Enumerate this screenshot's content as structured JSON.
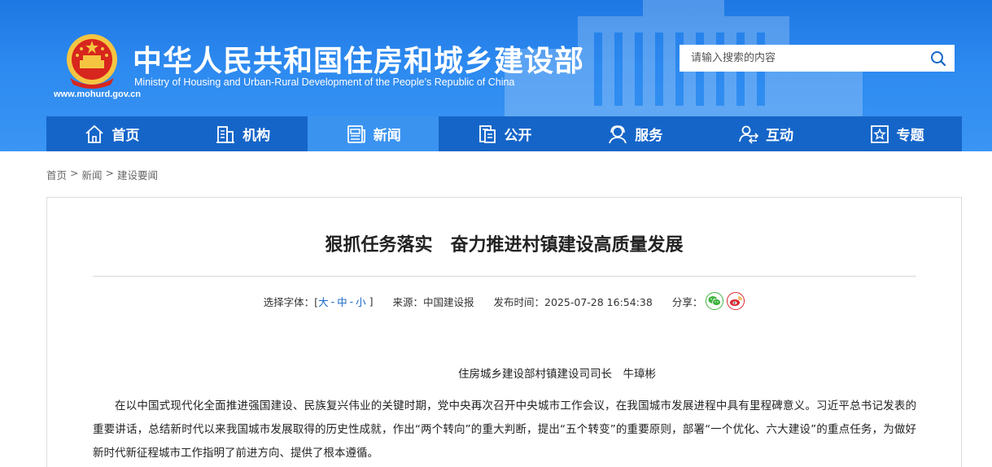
{
  "header": {
    "title": "中华人民共和国住房和城乡建设部",
    "subtitle": "Ministry of Housing and Urban-Rural Development of the People’s Republic of China",
    "url": "www.mohurd.gov.cn",
    "search_placeholder": "请输入搜索的内容"
  },
  "nav": {
    "items": [
      {
        "label": "首页",
        "icon": "home-icon"
      },
      {
        "label": "机构",
        "icon": "building-icon"
      },
      {
        "label": "新闻",
        "icon": "newspaper-icon",
        "active": true
      },
      {
        "label": "公开",
        "icon": "document-icon"
      },
      {
        "label": "服务",
        "icon": "service-icon"
      },
      {
        "label": "互动",
        "icon": "interact-icon"
      },
      {
        "label": "专题",
        "icon": "star-icon"
      }
    ]
  },
  "breadcrumb": {
    "items": [
      "首页",
      "新闻",
      "建设要闻"
    ],
    "separator": ">"
  },
  "article": {
    "title": "狠抓任务落实　奋力推进村镇建设高质量发展",
    "font_size_label": "选择字体：[",
    "font_size_large": "大",
    "font_size_medium": "中",
    "font_size_small": "小",
    "font_size_dash": "-",
    "font_size_close": "]",
    "source_label": "来源：中国建设报",
    "publish_label": "发布时间：2025-07-28 16:54:38",
    "share_label": "分享：",
    "author": "住房城乡建设部村镇建设司司长　牛璋彬",
    "paragraph": "在以中国式现代化全面推进强国建设、民族复兴伟业的关键时期，党中央再次召开中央城市工作会议，在我国城市发展进程中具有里程碑意义。习近平总书记发表的重要讲话，总结新时代以来我国城市发展取得的历史性成就，作出“两个转向”的重大判断，提出“五个转变”的重要原则，部署“一个优化、六大建设”的重点任务，为做好新时代新征程城市工作指明了前进方向、提供了根本遵循。"
  },
  "colors": {
    "header_blue": "#2d8af0",
    "nav_blue": "#1565c8",
    "nav_active": "#3b93f0",
    "link_blue": "#1565c8",
    "wechat_green": "#3db23d",
    "weibo_red": "#d9262f"
  }
}
